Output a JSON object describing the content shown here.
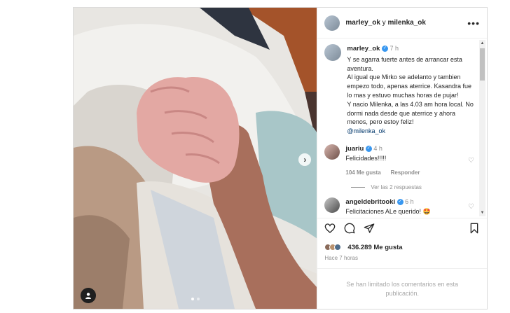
{
  "post": {
    "header": {
      "author": "marley_ok",
      "connector": " y ",
      "coauthor": "milenka_ok",
      "more_icon": "more-horizontal-icon"
    },
    "caption": {
      "username": "marley_ok",
      "time": "7 h",
      "text": "Y se agarra fuerte antes de arrancar esta aventura.\nAl igual que Mirko se adelanto y tambien empezo todo, apenas aterrice. Kasandra fue lo mas y estuvo muchas horas de pujar!\nY nacio Milenka, a las 4.03 am hora local. No dormi nada desde que aterrice y ahora menos, pero estoy feliz!",
      "mention": "@milenka_ok"
    },
    "comments": [
      {
        "username": "juariu",
        "time": "4 h",
        "text": "Felicidades!!!!!",
        "likes": "104 Me gusta",
        "reply_label": "Responder",
        "view_replies": "Ver las 2 respuestas"
      },
      {
        "username": "angeldebritooki",
        "time": "6 h",
        "text": "Felicitaciones ALe querido! 🤩"
      }
    ],
    "likes_count": "436.289 Me gusta",
    "posted_ago": "Hace 7 horas",
    "comments_limited": "Se han limitado los comentarios en esta publicación.",
    "carousel": {
      "current": 1,
      "total": 2
    },
    "icons": [
      "heart-icon",
      "comment-icon",
      "share-icon",
      "save-icon",
      "next-arrow-icon",
      "user-tag-icon",
      "verified-badge-icon"
    ],
    "colors": {
      "verified": "#3897f0",
      "mention": "#00376b",
      "muted": "#8e8e8e"
    }
  }
}
